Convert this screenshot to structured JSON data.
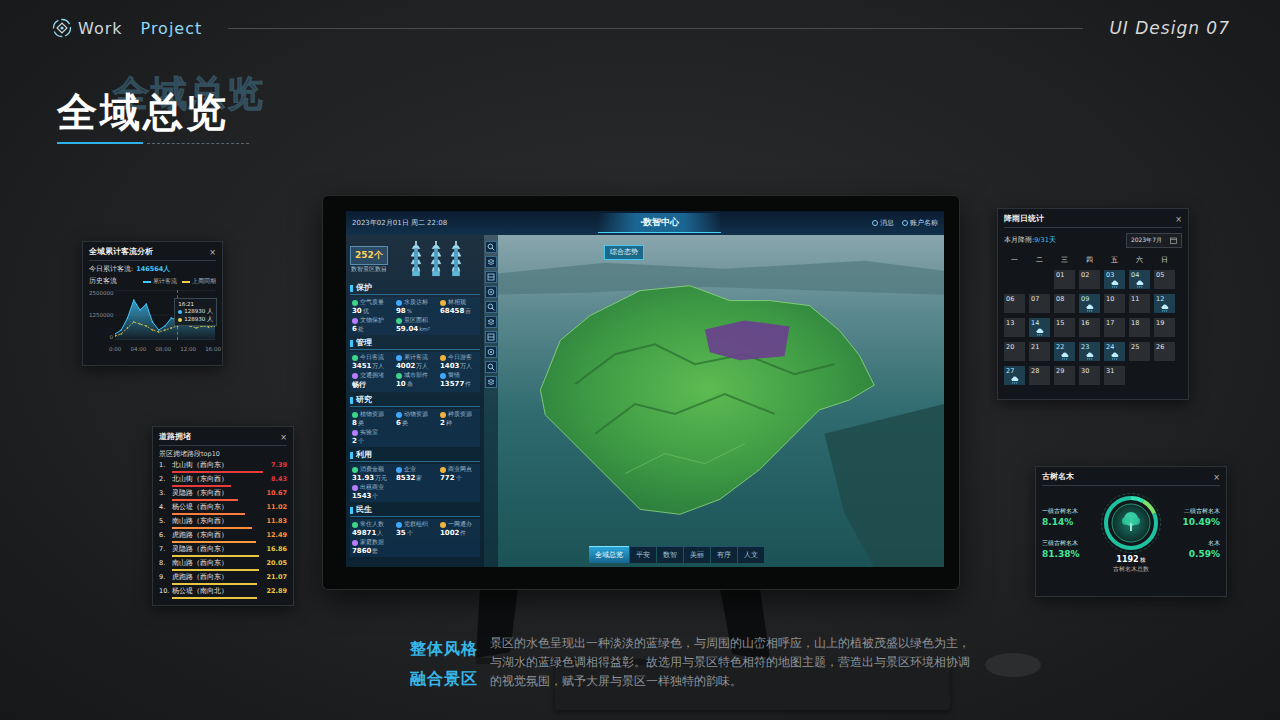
{
  "header": {
    "logo_words": [
      "Work",
      "Project"
    ],
    "tag": "UI Design 07"
  },
  "title": {
    "text": "全域总览",
    "echo": "全域总览"
  },
  "monitor": {
    "datetime": "2023年02月01日 周二 22:08",
    "center_title": "·数智中心",
    "top_links": [
      "消息",
      "账户名称"
    ],
    "map_button": "综合态势",
    "badge": {
      "value": "252个",
      "label": "数智景区数目"
    },
    "sections": [
      {
        "title": "保护",
        "items": [
          {
            "label": "空气质量",
            "value": "30",
            "unit": "优"
          },
          {
            "label": "水质达标",
            "value": "98",
            "unit": "%"
          },
          {
            "label": "林相观",
            "value": "68458",
            "unit": "亩"
          },
          {
            "label": "文物保护",
            "value": "6",
            "unit": "处"
          },
          {
            "label": "景区面积",
            "value": "59.04",
            "unit": "km²"
          }
        ]
      },
      {
        "title": "管理",
        "items": [
          {
            "label": "今日客流",
            "value": "3451",
            "unit": "万人"
          },
          {
            "label": "累计客流",
            "value": "4002",
            "unit": "万人"
          },
          {
            "label": "今日游客",
            "value": "1403",
            "unit": "万人"
          },
          {
            "label": "交通拥堵",
            "value": "畅行"
          },
          {
            "label": "城市部件",
            "value": "10",
            "unit": "条"
          },
          {
            "label": "警情",
            "value": "13577",
            "unit": "件"
          }
        ]
      },
      {
        "title": "研究",
        "items": [
          {
            "label": "植物资源",
            "value": "8",
            "unit": "类"
          },
          {
            "label": "动物资源",
            "value": "6",
            "unit": "类"
          },
          {
            "label": "种质资源",
            "value": "2",
            "unit": "种"
          },
          {
            "label": "实验室",
            "value": "2",
            "unit": "个"
          }
        ]
      },
      {
        "title": "利用",
        "items": [
          {
            "label": "消费金额",
            "value": "31.93",
            "unit": "万元"
          },
          {
            "label": "企业",
            "value": "8532",
            "unit": "家"
          },
          {
            "label": "商业网点",
            "value": "772",
            "unit": "个"
          },
          {
            "label": "出租商业",
            "value": "1543",
            "unit": "个"
          }
        ]
      },
      {
        "title": "民生",
        "items": [
          {
            "label": "常住人数",
            "value": "49871",
            "unit": "人"
          },
          {
            "label": "党群组织",
            "value": "35",
            "unit": "个"
          },
          {
            "label": "一网通办",
            "value": "1002",
            "unit": "件"
          },
          {
            "label": "家庭数据",
            "value": "7860",
            "unit": "套"
          }
        ]
      }
    ],
    "tabs": [
      {
        "label": "全域总览",
        "selected": true
      },
      {
        "label": "平安",
        "selected": false
      },
      {
        "label": "数智",
        "selected": false
      },
      {
        "label": "美丽",
        "selected": false
      },
      {
        "label": "有序",
        "selected": false
      },
      {
        "label": "人文",
        "selected": false
      }
    ]
  },
  "panels": {
    "traffic": {
      "title": "全域累计客流分析",
      "close": "×",
      "today_label": "今日累计客流:",
      "today_value": "146564人",
      "history_label": "历史客流",
      "legend": [
        {
          "label": "累计客流",
          "color": "#3fc8ff"
        },
        {
          "label": "上周同期",
          "color": "#e6cf4e"
        }
      ],
      "y_ticks": [
        "2500000",
        "1250000",
        "0"
      ],
      "y_max": 2500000,
      "x_ticks": [
        "0:00",
        "04:00",
        "08:00",
        "12:00",
        "16:00"
      ],
      "series": [
        {
          "values": [
            300000,
            500000,
            1100000,
            2000000,
            1500000,
            1800000,
            900000,
            500000,
            700000,
            1100000,
            1000000,
            1500000,
            1300000,
            900000,
            1200000,
            1000000,
            1300000
          ]
        },
        {
          "values": [
            200000,
            300000,
            600000,
            900000,
            800000,
            700000,
            500000,
            400000,
            500000,
            600000,
            700000,
            800000,
            700000,
            600000,
            700000,
            650000,
            700000
          ]
        }
      ],
      "tooltip": {
        "time": "16:21",
        "rows": [
          {
            "value": "128930 人"
          },
          {
            "value": "128930 人"
          }
        ]
      }
    },
    "roads": {
      "title": "道路拥堵",
      "close": "×",
      "subtitle": "景区拥堵路段top10",
      "rows": [
        {
          "rank": "1.",
          "name": "北山街（西向东）",
          "value": "7.39",
          "level": 0.95,
          "color": "#e8393b"
        },
        {
          "rank": "2.",
          "name": "北山街（东向西）",
          "value": "8.43",
          "level": 0.62,
          "color": "#e8393b"
        },
        {
          "rank": "3.",
          "name": "灵隐路（东向西）",
          "value": "10.67",
          "level": 0.72,
          "color": "#ff5a3a"
        },
        {
          "rank": "4.",
          "name": "杨公堤（西向东）",
          "value": "11.02",
          "level": 0.8,
          "color": "#ff7f3a"
        },
        {
          "rank": "5.",
          "name": "南山路（东向西）",
          "value": "11.83",
          "level": 0.88,
          "color": "#ff8c3a"
        },
        {
          "rank": "6.",
          "name": "虎跑路（东向西）",
          "value": "12.49",
          "level": 0.92,
          "color": "#ff9a3a"
        },
        {
          "rank": "7.",
          "name": "灵隐路（西向东）",
          "value": "16.86",
          "level": 0.95,
          "color": "#e8c640"
        },
        {
          "rank": "8.",
          "name": "南山路（西向东）",
          "value": "20.05",
          "level": 0.95,
          "color": "#e8c640"
        },
        {
          "rank": "9.",
          "name": "虎跑路（西向东）",
          "value": "21.07",
          "level": 0.93,
          "color": "#e8c640"
        },
        {
          "rank": "10.",
          "name": "杨公堤（南向北）",
          "value": "22.89",
          "level": 0.93,
          "color": "#e8c640"
        }
      ]
    },
    "rain": {
      "title": "降雨日统计",
      "close": "×",
      "month_label": "本月降雨:",
      "month_value": "9/31天",
      "month_select": "2023年7月",
      "weekdays": [
        "一",
        "二",
        "三",
        "四",
        "五",
        "六",
        "日"
      ],
      "leading_blank_days": 2,
      "days": [
        {
          "day": "01",
          "rain": false
        },
        {
          "day": "02",
          "rain": false
        },
        {
          "day": "03",
          "rain": true
        },
        {
          "day": "04",
          "rain": true
        },
        {
          "day": "05",
          "rain": false
        },
        {
          "day": "06",
          "rain": false
        },
        {
          "day": "07",
          "rain": false
        },
        {
          "day": "08",
          "rain": false
        },
        {
          "day": "09",
          "rain": true
        },
        {
          "day": "10",
          "rain": false
        },
        {
          "day": "11",
          "rain": false
        },
        {
          "day": "12",
          "rain": true
        },
        {
          "day": "13",
          "rain": false
        },
        {
          "day": "14",
          "rain": true
        },
        {
          "day": "15",
          "rain": false
        },
        {
          "day": "16",
          "rain": false
        },
        {
          "day": "17",
          "rain": false
        },
        {
          "day": "18",
          "rain": false
        },
        {
          "day": "19",
          "rain": false
        },
        {
          "day": "20",
          "rain": false
        },
        {
          "day": "21",
          "rain": false
        },
        {
          "day": "22",
          "rain": true
        },
        {
          "day": "23",
          "rain": true
        },
        {
          "day": "24",
          "rain": true
        },
        {
          "day": "25",
          "rain": false
        },
        {
          "day": "26",
          "rain": false
        },
        {
          "day": "27",
          "rain": true
        },
        {
          "day": "28",
          "rain": false
        },
        {
          "day": "29",
          "rain": false
        },
        {
          "day": "30",
          "rain": false
        },
        {
          "day": "31",
          "rain": false
        }
      ]
    },
    "trees": {
      "title": "古树名木",
      "close": "×",
      "total": "1192",
      "total_unit": "株",
      "total_label": "古树名木总数",
      "items": [
        {
          "label": "一级古树名木",
          "value": "8.14%",
          "level": 0.0814
        },
        {
          "label": "二级古树名木",
          "value": "10.49%",
          "level": 0.1049
        },
        {
          "label": "三级古树名木",
          "value": "81.38%",
          "level": 0.8138
        },
        {
          "label": "名木",
          "value": "0.59%",
          "level": 0.0059
        }
      ]
    }
  },
  "footer": {
    "heading": [
      "整体风格",
      "融合景区"
    ],
    "body": "景区的水色呈现出一种淡淡的蓝绿色，与周围的山峦相呼应，山上的植被茂盛以绿色为主，与湖水的蓝绿色调相得益彰。故选用与景区特色相符的地图主题，营造出与景区环境相协调的视觉氛围，赋予大屏与景区一样独特的韵味。"
  }
}
